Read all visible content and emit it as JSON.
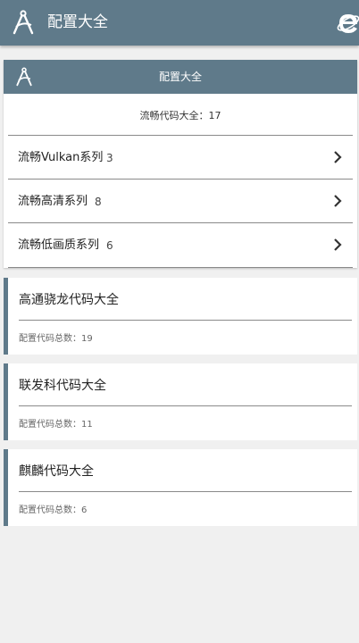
{
  "appbar": {
    "title": "配置大全",
    "logo_icon": "compass-icon",
    "browser_icon": "internet-explorer-icon",
    "color": "#5f7a8a"
  },
  "main_card": {
    "header_title": "配置大全",
    "summary": "流畅代码大全：17",
    "series": [
      {
        "label": "流畅Vulkan系列",
        "count": "3"
      },
      {
        "label": "流畅高清系列",
        "count": "8"
      },
      {
        "label": "流畅低画质系列",
        "count": "6"
      }
    ]
  },
  "vendors": [
    {
      "title": "高通骁龙代码大全",
      "subtitle": "配置代码总数：19"
    },
    {
      "title": "联发科代码大全",
      "subtitle": "配置代码总数：11"
    },
    {
      "title": "麒麟代码大全",
      "subtitle": "配置代码总数：6"
    }
  ]
}
